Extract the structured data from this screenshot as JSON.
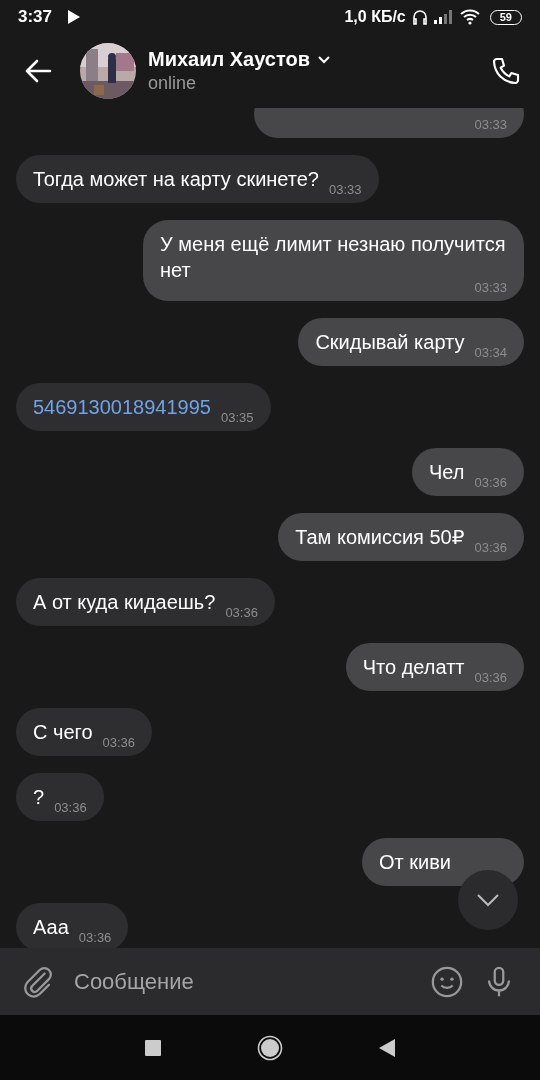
{
  "status_bar": {
    "time": "3:37",
    "speed": "1,0 КБ/с",
    "battery": "59"
  },
  "header": {
    "name": "Михаил Хаустов",
    "status": "online"
  },
  "messages": [
    {
      "kind": "out",
      "time": "03:33"
    },
    {
      "kind": "in",
      "text": "Тогда может на карту скинете?",
      "time": "03:33"
    },
    {
      "kind": "out",
      "text": "У меня ещё лимит незнаю получится нет",
      "time": "03:33"
    },
    {
      "kind": "out",
      "text": "Скидывай карту",
      "time": "03:34"
    },
    {
      "kind": "in",
      "text": "5469130018941995",
      "time": "03:35",
      "link": true
    },
    {
      "kind": "out",
      "text": "Чел",
      "time": "03:36"
    },
    {
      "kind": "out",
      "text": "Там комиссия 50₽",
      "time": "03:36"
    },
    {
      "kind": "in",
      "text": "А от куда кидаешь?",
      "time": "03:36"
    },
    {
      "kind": "out",
      "text": "Что делатт",
      "time": "03:36"
    },
    {
      "kind": "in",
      "text": "С чего",
      "time": "03:36"
    },
    {
      "kind": "in",
      "text": "?",
      "time": "03:36"
    },
    {
      "kind": "out",
      "text": "От киви"
    },
    {
      "kind": "in",
      "text": "Ааа",
      "time": "03:36"
    }
  ],
  "composer": {
    "placeholder": "Сообщение"
  }
}
